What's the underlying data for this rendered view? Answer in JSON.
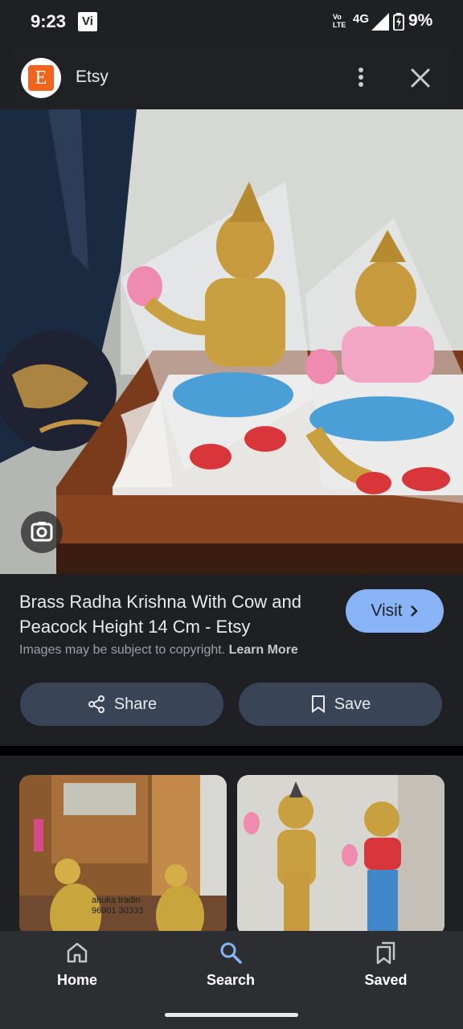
{
  "status": {
    "time": "9:23",
    "carrier_badge": "Vi",
    "volte": "Vo LTE",
    "network": "4G",
    "battery_pct": "9%"
  },
  "header": {
    "logo_letter": "E",
    "site_name": "Etsy",
    "icons": [
      "more-vert-icon",
      "close-icon"
    ]
  },
  "result": {
    "title": "Brass Radha Krishna With Cow and Peacock Height 14 Cm - Etsy",
    "visit_label": "Visit",
    "copyright_text": "Images may be subject to copyright.",
    "learn_more": "Learn More",
    "share_label": "Share",
    "save_label": "Save"
  },
  "related": {
    "thumb1_watermark": "anuka tradin\n96901 30333"
  },
  "nav": {
    "home": "Home",
    "search": "Search",
    "saved": "Saved"
  },
  "colors": {
    "accent": "#8ab4f8",
    "button_bg": "#394457",
    "background": "#1f2023",
    "etsy_orange": "#f1641e"
  }
}
